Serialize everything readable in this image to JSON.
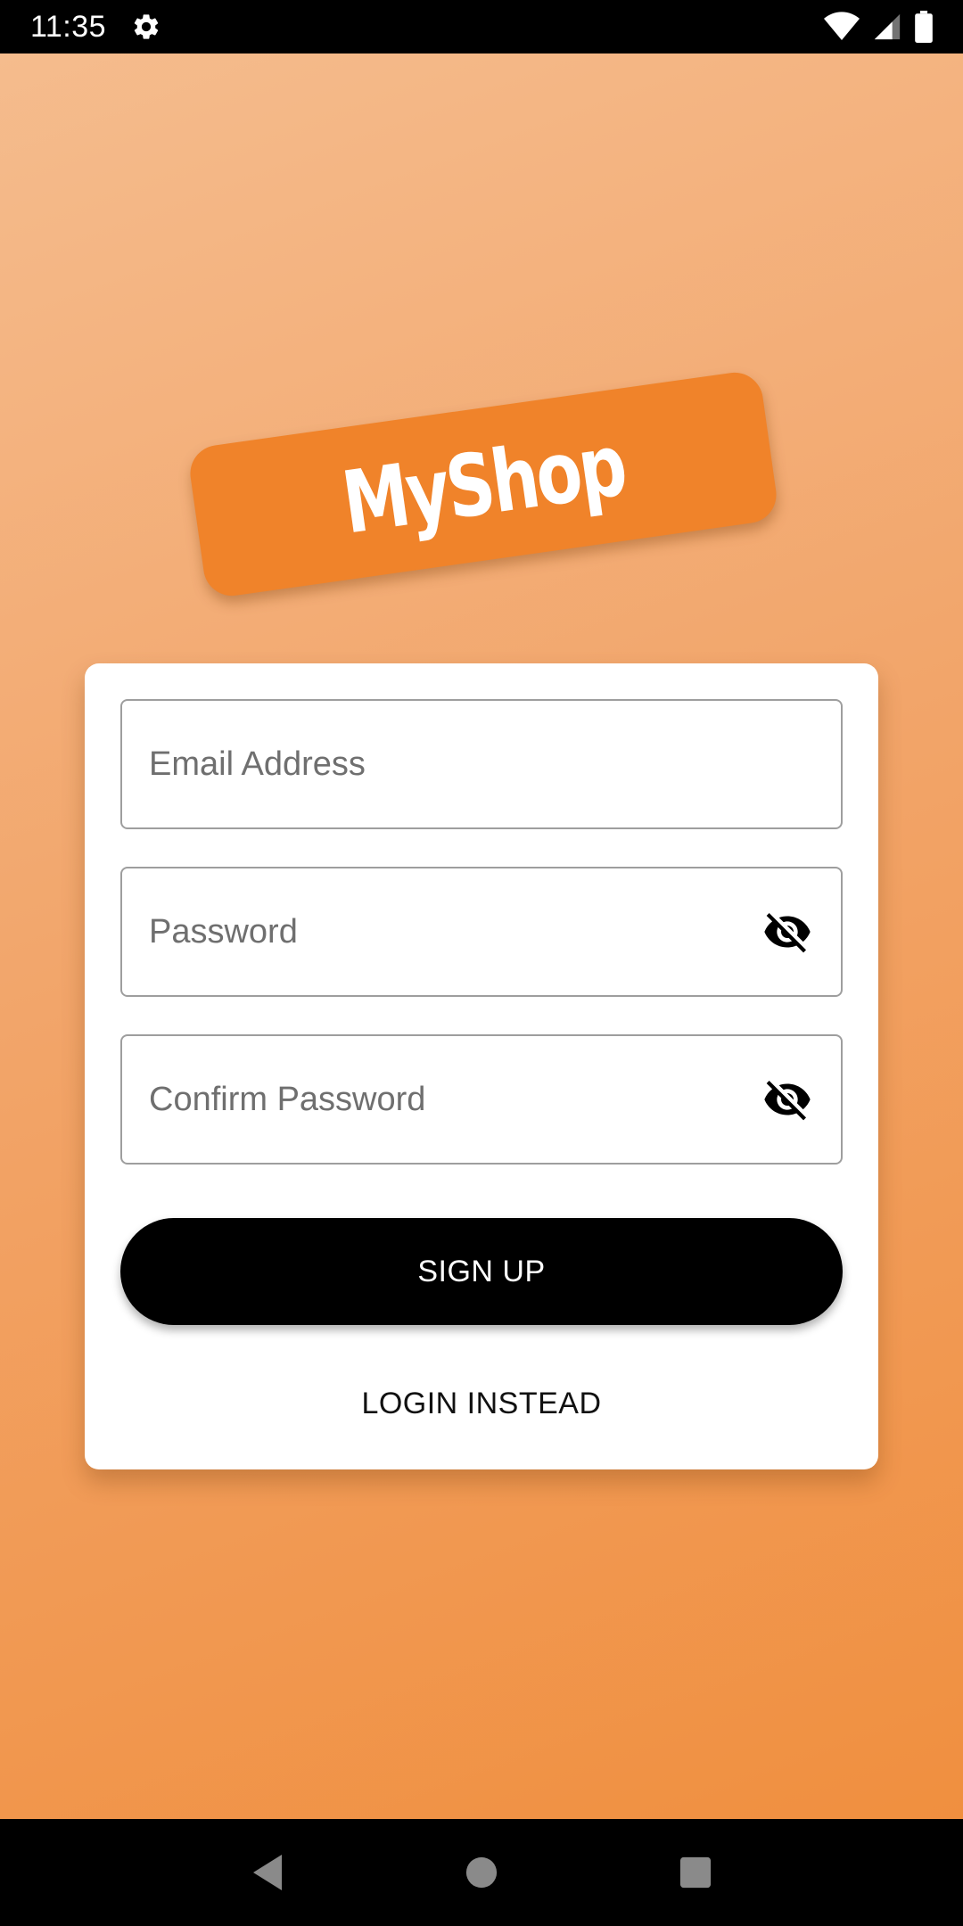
{
  "status_bar": {
    "time": "11:35",
    "icons": [
      "gear-icon",
      "wifi-icon",
      "signal-icon",
      "battery-icon"
    ]
  },
  "logo": {
    "text": "MyShop",
    "color": "#f0832a"
  },
  "form": {
    "email": {
      "placeholder": "Email Address",
      "value": ""
    },
    "password": {
      "placeholder": "Password",
      "value": "",
      "icon": "eye-off-icon"
    },
    "confirm_password": {
      "placeholder": "Confirm Password",
      "value": "",
      "icon": "eye-off-icon"
    },
    "signup_label": "SIGN UP",
    "login_label": "LOGIN INSTEAD"
  },
  "nav_bar": {
    "icons": [
      "back-icon",
      "home-icon",
      "recents-icon"
    ]
  },
  "colors": {
    "accent": "#f0832a",
    "button": "#000000",
    "background_top": "#f5bd8f",
    "background_bottom": "#f08d3b"
  }
}
